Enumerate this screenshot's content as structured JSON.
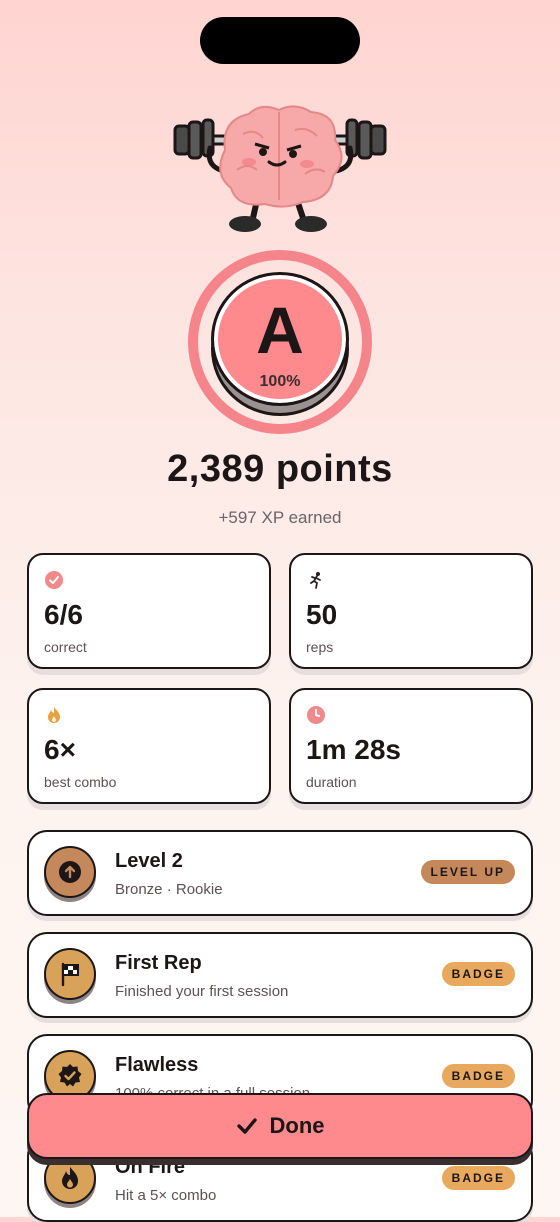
{
  "grade": {
    "letter": "A",
    "percent": "100%"
  },
  "score": {
    "points": "2,389 points",
    "xp": "+597 XP earned"
  },
  "stats": [
    {
      "icon": "check-circle-icon",
      "value": "6/6",
      "label": "correct"
    },
    {
      "icon": "running-person-icon",
      "value": "50",
      "label": "reps"
    },
    {
      "icon": "flame-icon",
      "value": "6×",
      "label": "best combo"
    },
    {
      "icon": "clock-icon",
      "value": "1m 28s",
      "label": "duration"
    }
  ],
  "achievements": [
    {
      "icon": "arrow-up-icon",
      "title": "Level 2",
      "subtitle": "Bronze · Rookie",
      "tag": "LEVEL UP"
    },
    {
      "icon": "checkered-flag-icon",
      "title": "First Rep",
      "subtitle": "Finished your first session",
      "tag": "BADGE"
    },
    {
      "icon": "verified-badge-icon",
      "title": "Flawless",
      "subtitle": "100% correct in a full session",
      "tag": "BADGE"
    },
    {
      "icon": "flame-icon",
      "title": "On Fire",
      "subtitle": "Hit a 5× combo",
      "tag": "BADGE"
    }
  ],
  "done_button": {
    "label": "Done",
    "icon": "checkmark-icon"
  },
  "colors": {
    "accent": "#fe8a8e",
    "ring": "#f5858a",
    "level_tag": "#c4885a",
    "badge_tag": "#e8a85e",
    "ink": "#1d1616"
  }
}
